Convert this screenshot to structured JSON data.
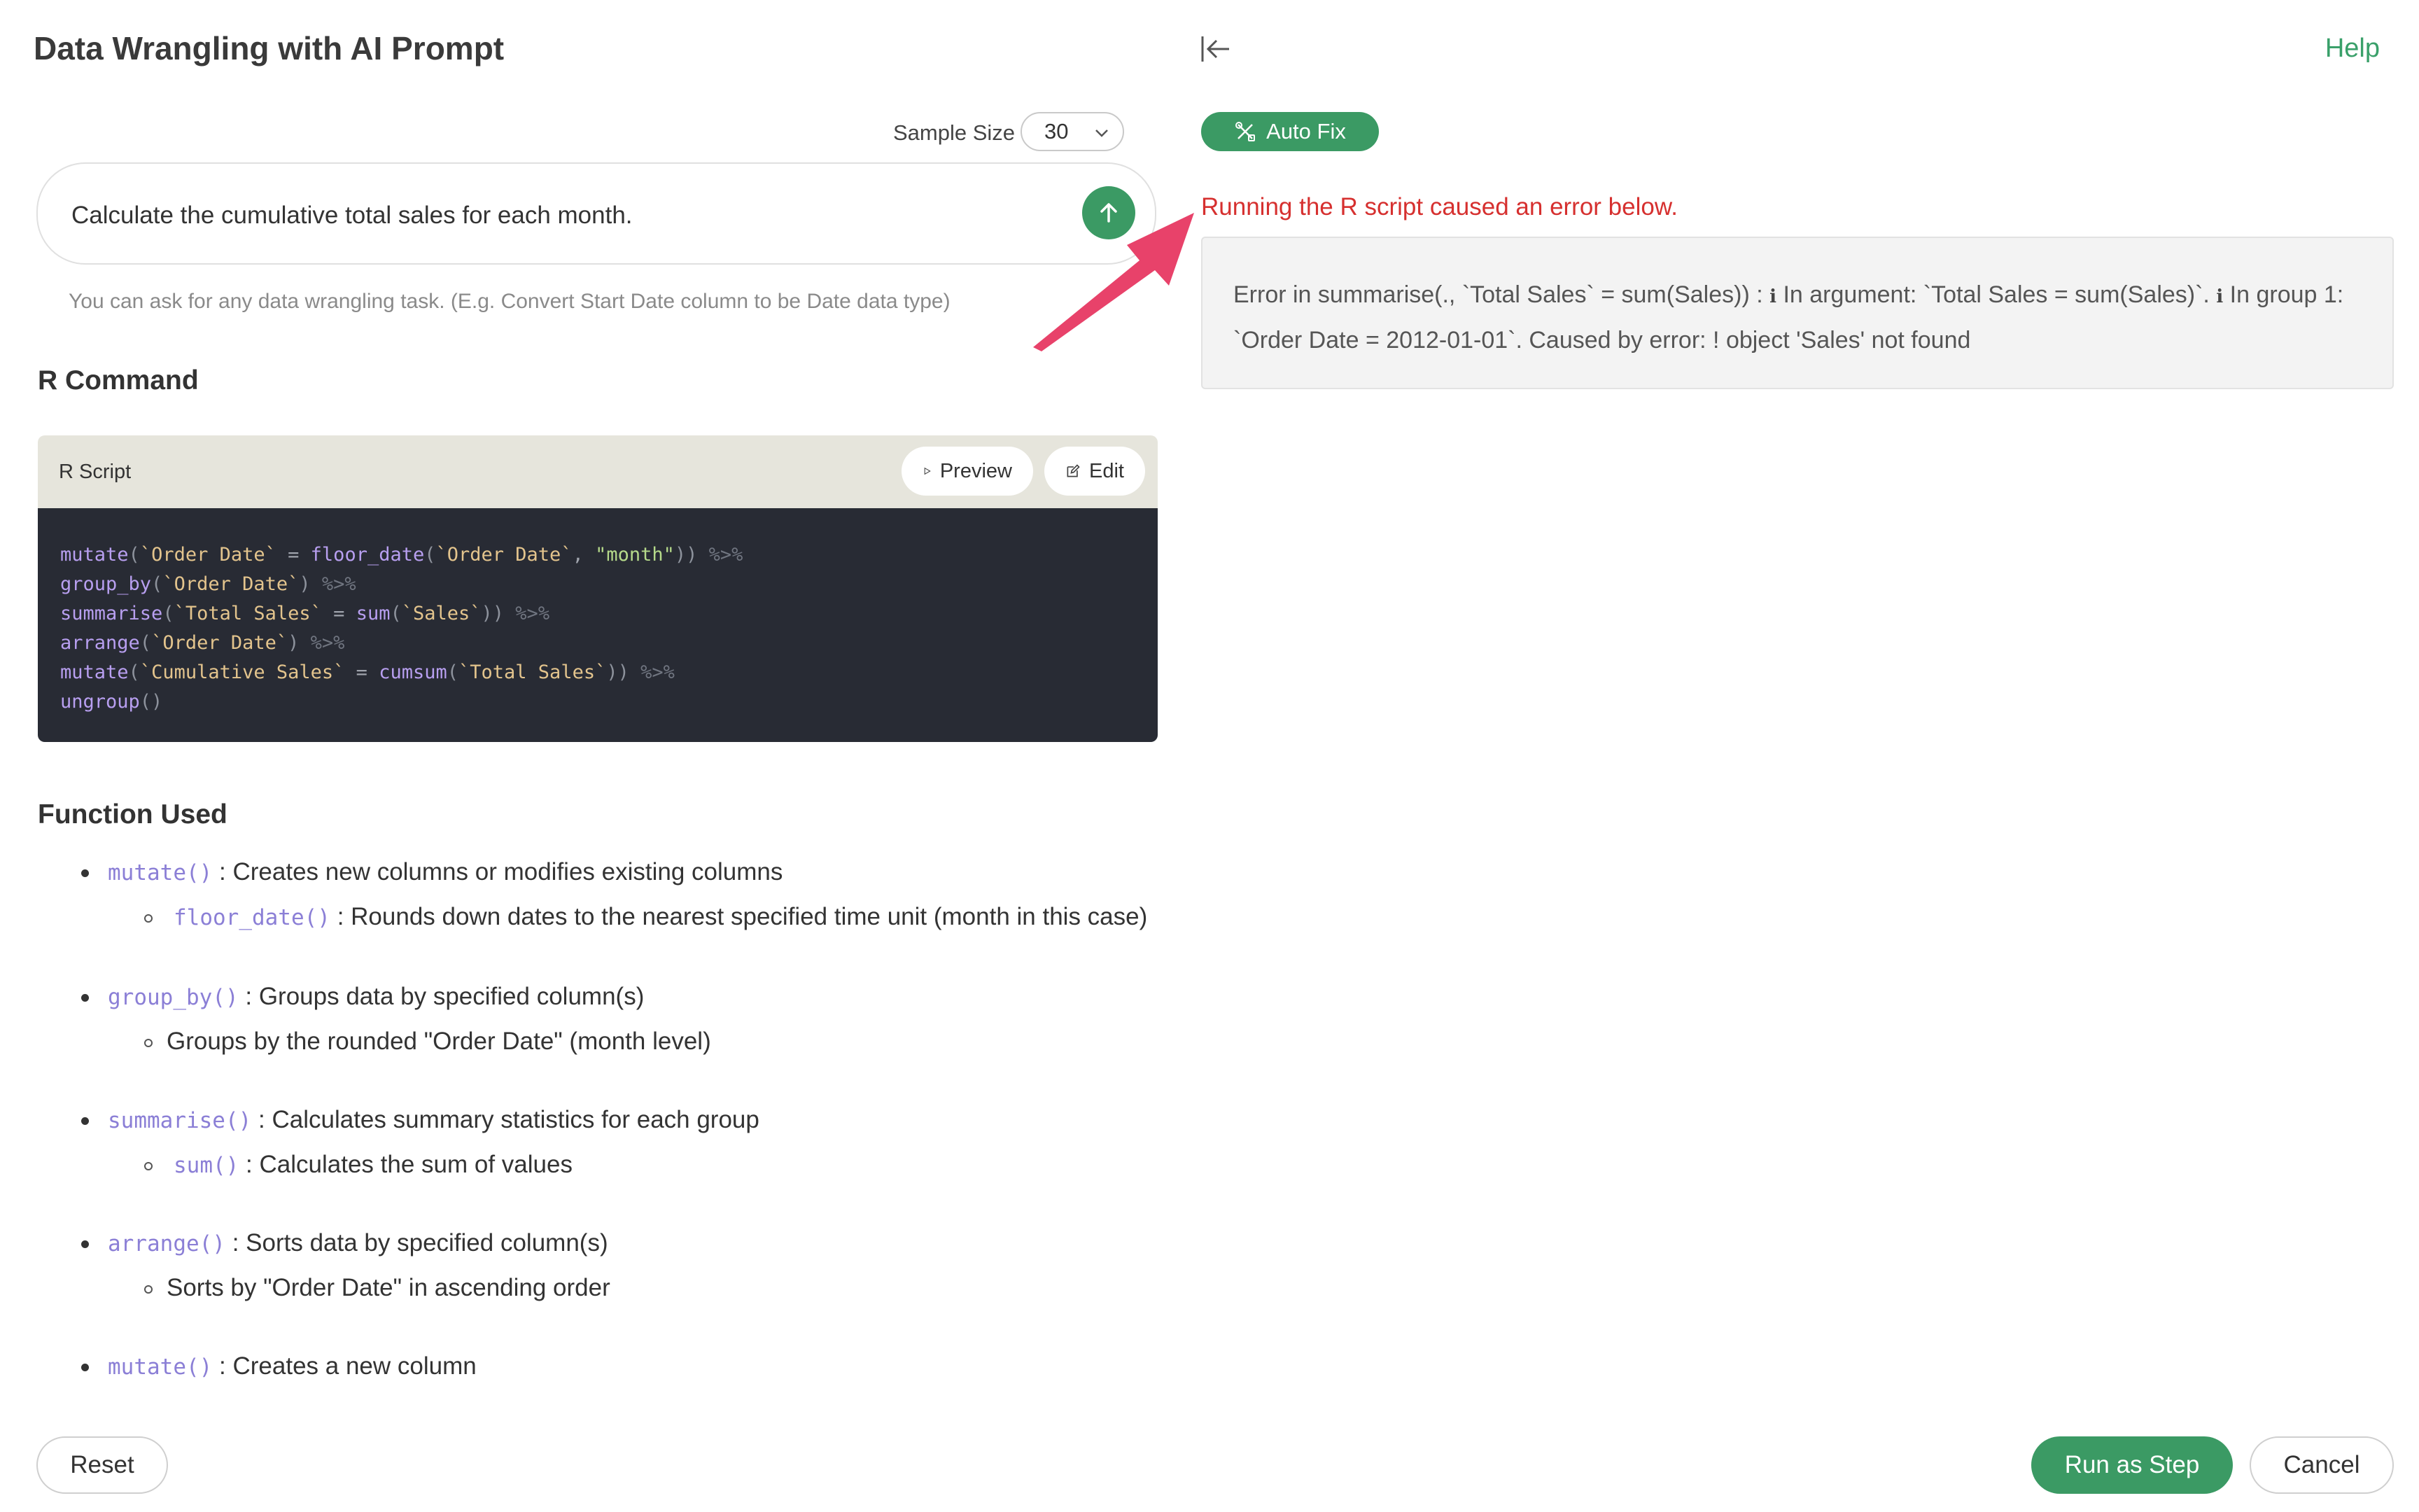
{
  "page": {
    "title": "Data Wrangling with AI Prompt",
    "help_label": "Help"
  },
  "sample": {
    "label": "Sample Size",
    "value": "30"
  },
  "prompt": {
    "text": "Calculate the cumulative total sales for each month.",
    "hint": "You can ask for any data wrangling task. (E.g. Convert Start Date column to be Date data type)"
  },
  "r_command": {
    "heading": "R Command",
    "script_label": "R Script",
    "preview_label": "Preview",
    "edit_label": "Edit",
    "code": {
      "l1": [
        "mutate",
        "(",
        "`Order Date`",
        " = ",
        "floor_date",
        "(",
        "`Order Date`",
        ", ",
        "\"month\"",
        "))",
        " %>%"
      ],
      "l2": [
        "group_by",
        "(",
        "`Order Date`",
        ")",
        " %>%"
      ],
      "l3": [
        "summarise",
        "(",
        "`Total Sales`",
        " = ",
        "sum",
        "(",
        "`Sales`",
        "))",
        " %>%"
      ],
      "l4": [
        "arrange",
        "(",
        "`Order Date`",
        ")",
        " %>%"
      ],
      "l5": [
        "mutate",
        "(",
        "`Cumulative Sales`",
        " = ",
        "cumsum",
        "(",
        "`Total Sales`",
        "))",
        " %>%"
      ],
      "l6": [
        "ungroup",
        "()"
      ]
    }
  },
  "functions": {
    "heading": "Function Used",
    "items": [
      {
        "fn": "mutate()",
        "desc": " : Creates new columns or modifies existing columns"
      },
      {
        "fn": "floor_date()",
        "desc": " : Rounds down dates to the nearest specified time unit (month in this case)"
      },
      {
        "fn": "group_by()",
        "desc": " : Groups data by specified column(s)"
      },
      {
        "fn": "",
        "desc": "Groups by the rounded \"Order Date\" (month level)"
      },
      {
        "fn": "summarise()",
        "desc": " : Calculates summary statistics for each group"
      },
      {
        "fn": "sum()",
        "desc": " : Calculates the sum of values"
      },
      {
        "fn": "arrange()",
        "desc": " : Sorts data by specified column(s)"
      },
      {
        "fn": "",
        "desc": "Sorts by \"Order Date\" in ascending order"
      },
      {
        "fn": "mutate()",
        "desc": " : Creates a new column"
      }
    ]
  },
  "autofix": {
    "label": "Auto Fix"
  },
  "error": {
    "title": "Running the R script caused an error below.",
    "part1": "Error in summarise(., `Total Sales` = sum(Sales)) : ",
    "info": "i",
    "part2": " In argument: `Total Sales = sum(Sales)`. ",
    "part3": " In group 1: `Order Date = 2012-01-01`. Caused by error: ! object 'Sales' not found"
  },
  "footer": {
    "reset_label": "Reset",
    "run_label": "Run as Step",
    "cancel_label": "Cancel"
  },
  "colors": {
    "accent": "#3b9a64",
    "error": "#d6302f",
    "annotation_arrow": "#e8426a"
  }
}
